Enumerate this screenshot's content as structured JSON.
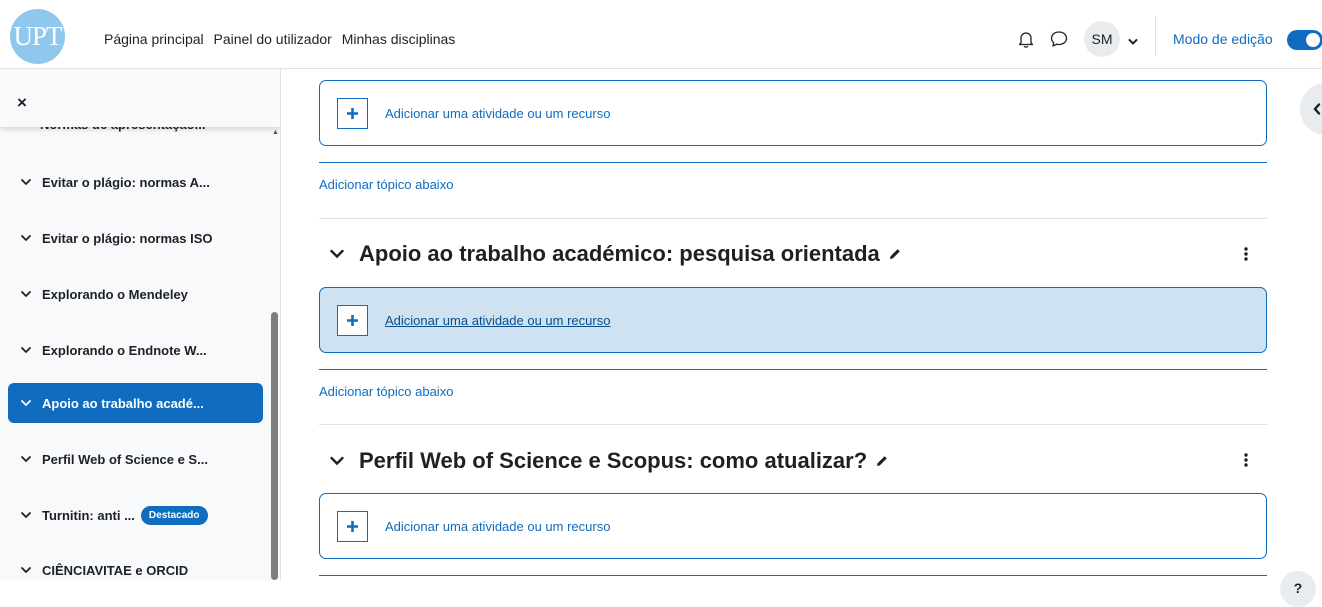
{
  "navbar": {
    "logo_text": "UPT",
    "links": [
      "Página principal",
      "Painel do utilizador",
      "Minhas disciplinas"
    ],
    "user_initials": "SM",
    "edit_mode_label": "Modo de edição",
    "edit_mode_on": true
  },
  "drawer": {
    "close_symbol": "×",
    "truncated_item": "Normas de apresentação...",
    "items": [
      {
        "label": "Evitar o plágio: normas A..."
      },
      {
        "label": "Evitar o plágio: normas ISO"
      },
      {
        "label": "Explorando o Mendeley"
      },
      {
        "label": "Explorando o Endnote W..."
      },
      {
        "label": "Apoio ao trabalho acadé...",
        "active": true
      },
      {
        "label": "Perfil Web of Science e S..."
      },
      {
        "label": "Turnitin: anti ...",
        "badge": "Destacado"
      },
      {
        "label": "CIÊNCIAVITAE e ORCID"
      }
    ]
  },
  "main": {
    "add_activity_label": "Adicionar uma atividade ou um recurso",
    "add_topic_label": "Adicionar tópico abaixo",
    "sections": [
      {
        "title": "Apoio ao trabalho académico: pesquisa orientada"
      },
      {
        "title": "Perfil Web of Science e Scopus: como atualizar?"
      }
    ]
  },
  "help_label": "?",
  "colors": {
    "accent": "#0f6cbf",
    "hover_bg": "#cfe2f1",
    "drawer_bg": "#f8f9fa"
  }
}
